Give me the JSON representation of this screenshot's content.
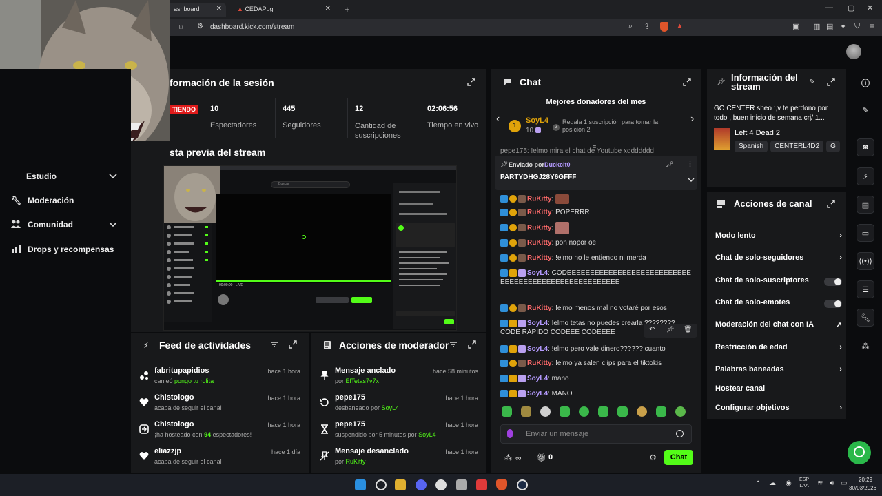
{
  "browser": {
    "tabs": [
      {
        "label": "ashboard"
      },
      {
        "label": "CEDAPug"
      }
    ],
    "url": "dashboard.kick.com/stream"
  },
  "sidebar": {
    "items": [
      {
        "label": "Estudio"
      },
      {
        "label": "Moderación"
      },
      {
        "label": "Comunidad"
      },
      {
        "label": "Drops y recompensas"
      }
    ]
  },
  "session": {
    "title": "formación de la sesión",
    "live_badge": "TIENDO",
    "stats": [
      {
        "value": "10",
        "label": "Espectadores"
      },
      {
        "value": "445",
        "label": "Seguidores"
      },
      {
        "value": "12",
        "label": "Cantidad de suscripciones"
      },
      {
        "value": "02:06:56",
        "label": "Tiempo en vivo"
      }
    ]
  },
  "preview": {
    "title": "sta previa del stream",
    "search_placeholder": "Buscar",
    "live_label": "LIVE",
    "time": "00:00:00"
  },
  "feed": {
    "title": "Feed de actividades",
    "items": [
      {
        "name": "fabritupapidios",
        "pre": "canjeó ",
        "highlight": "pongo tu rolita",
        "post": "",
        "time": "hace 1 hora",
        "icon": "gift-icon"
      },
      {
        "name": "Chistologo",
        "pre": "acaba de seguir el canal",
        "highlight": "",
        "post": "",
        "time": "hace 1 hora",
        "icon": "heart-icon"
      },
      {
        "name": "Chistologo",
        "pre": "¡ha hosteado con ",
        "highlight": "94",
        "post": " espectadores!",
        "time": "hace 1 hora",
        "icon": "host-icon"
      },
      {
        "name": "eliazzjp",
        "pre": "acaba de seguir el canal",
        "highlight": "",
        "post": "",
        "time": "hace 1 día",
        "icon": "heart-icon"
      }
    ]
  },
  "modactions": {
    "title": "Acciones de moderador",
    "items": [
      {
        "name": "Mensaje anclado",
        "pre": "por ",
        "highlight": "ElTetas7v7x",
        "time": "hace 58 minutos",
        "icon": "pin-icon"
      },
      {
        "name": "pepe175",
        "pre": "desbaneado por ",
        "highlight": "SoyL4",
        "time": "hace 1 hora",
        "icon": "unban-icon"
      },
      {
        "name": "pepe175",
        "pre": "suspendido por 5 minutos por ",
        "highlight": "SoyL4",
        "time": "hace 1 hora",
        "icon": "hourglass-icon"
      },
      {
        "name": "Mensaje desanclado",
        "pre": "por ",
        "highlight": "RuKitty",
        "time": "hace 1 hora",
        "icon": "unpin-icon"
      }
    ]
  },
  "chat": {
    "title": "Chat",
    "donors_title": "Mejores donadores del mes",
    "donor": {
      "rank": "1",
      "name": "SoyL4",
      "amount": "10"
    },
    "donor_cta": {
      "rank": "2",
      "text": "Regala 1 suscripción para tomar la posición 2"
    },
    "partial_msg": "pepe175: !elmo mira el chat de Youtube xddddddd",
    "pinned": {
      "label": "Enviado por",
      "by": "Duckcit0",
      "text": "PARTYDHGJ28Y6GFFF"
    },
    "messages": [
      {
        "user": "RuKitty",
        "text": "",
        "emote": true,
        "crown": false
      },
      {
        "user": "RuKitty",
        "text": "POPERRR",
        "emote": false,
        "crown": false
      },
      {
        "user": "RuKitty",
        "text": "",
        "emote": true,
        "crown": false
      },
      {
        "user": "RuKitty",
        "text": "pon nopor oe",
        "emote": false,
        "crown": false
      },
      {
        "user": "RuKitty",
        "text": "!elmo no le entiendo ni merda",
        "emote": false,
        "crown": false
      },
      {
        "user": "SoyL4",
        "text": "CODEEEEEEEEEEEEEEEEEEEEEEEEEEEEEEEEEEEEEEEEEEEEEEEEEEEEE",
        "emote": false,
        "crown": true
      },
      {
        "user": "RuKitty",
        "text": "!elmo menos mal no votaré por esos",
        "emote": false,
        "crown": false
      },
      {
        "user": "SoyL4",
        "text": "!elmo tetas no puedes crearla ???????? CODE RAPIDO CODEEE CODEEEE",
        "emote": false,
        "crown": true
      },
      {
        "user": "SoyL4",
        "text": "!elmo pero vale dinero?????? cuanto",
        "emote": false,
        "crown": true
      },
      {
        "user": "RuKitty",
        "text": "!elmo ya salen clips para el tiktokis",
        "emote": false,
        "crown": false
      },
      {
        "user": "SoyL4",
        "text": "mano",
        "emote": false,
        "crown": true
      },
      {
        "user": "SoyL4",
        "text": "MANO",
        "emote": false,
        "crown": true
      }
    ],
    "input_placeholder": "Enviar un mensaje",
    "points": "0",
    "send_label": "Chat"
  },
  "stream_info": {
    "title": "Información del stream",
    "description": "GO CENTER sheo :,v te perdono por todo , buen inicio de semana crj/ 1...",
    "category": "Left 4 Dead 2",
    "tags": [
      "Spanish",
      "CENTERL4D2",
      "G"
    ]
  },
  "channel_actions": {
    "title": "Acciones de canal",
    "items": [
      {
        "label": "Modo lento",
        "control": "arrow"
      },
      {
        "label": "Chat de solo-seguidores",
        "control": "arrow"
      },
      {
        "label": "Chat de solo-suscriptores",
        "control": "toggle"
      },
      {
        "label": "Chat de solo-emotes",
        "control": "toggle"
      },
      {
        "label": "Moderación del chat con IA",
        "control": "external"
      },
      {
        "label": "Restricción de edad",
        "control": "arrow"
      },
      {
        "label": "Palabras baneadas",
        "control": "arrow"
      },
      {
        "label": "Hostear canal",
        "control": "none"
      },
      {
        "label": "Configurar objetivos",
        "control": "arrow"
      }
    ]
  },
  "taskbar": {
    "lang": "ESP\nLAA",
    "time": "20:29",
    "date": "30/03/2026"
  },
  "colors": {
    "accent": "#53fc18",
    "panel": "#18191b",
    "bg": "#0b0c0e"
  }
}
